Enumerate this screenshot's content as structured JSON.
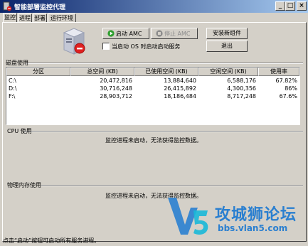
{
  "window": {
    "title": "智能部署监控代理",
    "controls": {
      "minimize": "_",
      "maximize": "□",
      "close": "×"
    }
  },
  "tabs": [
    {
      "label": "监控",
      "active": true
    },
    {
      "label": "进程",
      "active": false
    },
    {
      "label": "部署",
      "active": false
    },
    {
      "label": "运行环境",
      "active": false
    }
  ],
  "toolbar": {
    "start_label": "启动 AMC",
    "stop_label": "停止 AMC",
    "autostart_label": "当启动 OS 时启动启动服务",
    "autostart_checked": false,
    "install_label": "安装新组件",
    "exit_label": "退出"
  },
  "disk": {
    "section_label": "磁盘使用",
    "columns": [
      "分区",
      "总空间 (KB)",
      "已使用空间 (KB)",
      "空闲空间 (KB)",
      "使用率"
    ],
    "rows": [
      {
        "partition": "C:\\",
        "total": "20,472,816",
        "used": "13,884,640",
        "free": "6,588,176",
        "usage": "67.82%"
      },
      {
        "partition": "D:\\",
        "total": "30,716,248",
        "used": "26,415,892",
        "free": "4,300,356",
        "usage": "86%"
      },
      {
        "partition": "F:\\",
        "total": "28,903,712",
        "used": "18,186,484",
        "free": "8,717,248",
        "usage": "67.6%"
      }
    ]
  },
  "cpu": {
    "section_label": "CPU 使用",
    "message": "监控进程未启动，无法获得监控数据。"
  },
  "memory": {
    "section_label": "物理内存使用",
    "message": "监控进程未启动，无法获得监控数据。"
  },
  "status": {
    "text": "点击“启动”按钮可启动所有服务进程。"
  },
  "watermark": {
    "logo": "V5",
    "title": "攻城狮论坛",
    "url": "bbs.vlan5.com"
  },
  "colors": {
    "face": "#d4d0c8",
    "title_start": "#0a246a",
    "title_end": "#a6caf0",
    "start_icon": "#2e9e2e",
    "stop_icon": "#8c8c8c",
    "alert_red": "#e02020",
    "watermark_blue": "#2a7fd0",
    "watermark_cyan": "#18b8d8"
  }
}
